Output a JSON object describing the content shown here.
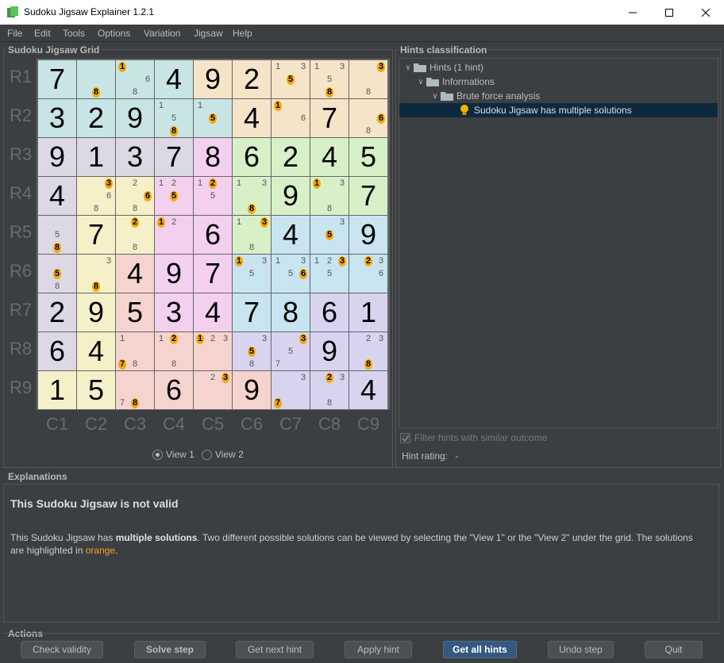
{
  "window": {
    "title": "Sudoku Jigsaw Explainer 1.2.1",
    "min": "—",
    "max": "☐",
    "close": "✕"
  },
  "menu": [
    "File",
    "Edit",
    "Tools",
    "Options",
    "Variation",
    "Jigsaw",
    "Help"
  ],
  "grid_panel": {
    "title": "Sudoku Jigsaw Grid"
  },
  "rows": [
    "R1",
    "R2",
    "R3",
    "R4",
    "R5",
    "R6",
    "R7",
    "R8",
    "R9"
  ],
  "cols": [
    "C1",
    "C2",
    "C3",
    "C4",
    "C5",
    "C6",
    "C7",
    "C8",
    "C9"
  ],
  "colors": {
    "A": "#c8e4e4",
    "B": "#f5e4c8",
    "C": "#dcd8e4",
    "D": "#d8f0c8",
    "E": "#f2d0ee",
    "F": "#f5f0c8",
    "G": "#c8e4f0",
    "H": "#f5d4d0",
    "I": "#d8d4f0"
  },
  "grid": [
    [
      {
        "v": "7",
        "r": "A"
      },
      {
        "c": "8",
        "h": "8",
        "r": "A"
      },
      {
        "c": "168",
        "h": "1",
        "r": "A"
      },
      {
        "v": "4",
        "r": "A"
      },
      {
        "v": "9",
        "r": "B"
      },
      {
        "v": "2",
        "r": "B"
      },
      {
        "c": "135",
        "h": "5",
        "r": "B"
      },
      {
        "c": "1358",
        "h": "8",
        "r": "B"
      },
      {
        "c": "38",
        "h": "3",
        "r": "B"
      }
    ],
    [
      {
        "v": "3",
        "r": "A"
      },
      {
        "v": "2",
        "r": "A"
      },
      {
        "v": "9",
        "r": "A"
      },
      {
        "c": "158",
        "h": "8",
        "r": "A"
      },
      {
        "c": "15",
        "h": "5",
        "r": "A"
      },
      {
        "v": "4",
        "r": "B"
      },
      {
        "c": "16",
        "h": "1",
        "r": "B"
      },
      {
        "v": "7",
        "r": "B"
      },
      {
        "c": "68",
        "h": "6",
        "r": "B"
      }
    ],
    [
      {
        "v": "9",
        "r": "C"
      },
      {
        "v": "1",
        "r": "C"
      },
      {
        "v": "3",
        "r": "C"
      },
      {
        "v": "7",
        "r": "C"
      },
      {
        "v": "8",
        "r": "E"
      },
      {
        "v": "6",
        "r": "D"
      },
      {
        "v": "2",
        "r": "D"
      },
      {
        "v": "4",
        "r": "D"
      },
      {
        "v": "5",
        "r": "D"
      }
    ],
    [
      {
        "v": "4",
        "r": "C"
      },
      {
        "c": "368",
        "h": "3",
        "r": "F"
      },
      {
        "c": "268",
        "h": "6",
        "r": "F"
      },
      {
        "c": "125",
        "h": "5",
        "r": "E"
      },
      {
        "c": "125",
        "h": "2",
        "r": "E"
      },
      {
        "c": "138",
        "h": "8",
        "r": "D"
      },
      {
        "v": "9",
        "r": "D"
      },
      {
        "c": "138",
        "h": "1",
        "r": "D"
      },
      {
        "v": "7",
        "r": "D"
      }
    ],
    [
      {
        "c": "58",
        "h": "8",
        "r": "C"
      },
      {
        "v": "7",
        "r": "F"
      },
      {
        "c": "28",
        "h": "2",
        "r": "F"
      },
      {
        "c": "12",
        "h": "1",
        "r": "E"
      },
      {
        "v": "6",
        "r": "E"
      },
      {
        "c": "138",
        "h": "3",
        "r": "D"
      },
      {
        "v": "4",
        "r": "G"
      },
      {
        "c": "35",
        "h": "5",
        "r": "G"
      },
      {
        "v": "9",
        "r": "G"
      }
    ],
    [
      {
        "c": "58",
        "h": "5",
        "r": "C"
      },
      {
        "c": "38",
        "h": "8",
        "r": "F"
      },
      {
        "v": "4",
        "r": "H"
      },
      {
        "v": "9",
        "r": "E"
      },
      {
        "v": "7",
        "r": "E"
      },
      {
        "c": "135",
        "h": "1",
        "r": "G"
      },
      {
        "c": "1356",
        "h": "6",
        "r": "G"
      },
      {
        "c": "1235",
        "h": "3",
        "r": "G"
      },
      {
        "c": "236",
        "h": "2",
        "r": "G"
      }
    ],
    [
      {
        "v": "2",
        "r": "C"
      },
      {
        "v": "9",
        "r": "F"
      },
      {
        "v": "5",
        "r": "H"
      },
      {
        "v": "3",
        "r": "E"
      },
      {
        "v": "4",
        "r": "E"
      },
      {
        "v": "7",
        "r": "G"
      },
      {
        "v": "8",
        "r": "G"
      },
      {
        "v": "6",
        "r": "I"
      },
      {
        "v": "1",
        "r": "I"
      }
    ],
    [
      {
        "v": "6",
        "r": "C"
      },
      {
        "v": "4",
        "r": "F"
      },
      {
        "c": "178",
        "h": "7",
        "r": "H"
      },
      {
        "c": "128",
        "h": "2",
        "r": "H"
      },
      {
        "c": "123",
        "h": "1",
        "r": "H"
      },
      {
        "c": "358",
        "h": "5",
        "r": "I"
      },
      {
        "c": "357",
        "h": "3",
        "r": "I"
      },
      {
        "v": "9",
        "r": "I"
      },
      {
        "c": "238",
        "h": "8",
        "r": "I"
      }
    ],
    [
      {
        "v": "1",
        "r": "F"
      },
      {
        "v": "5",
        "r": "F"
      },
      {
        "c": "78",
        "h": "8",
        "r": "H"
      },
      {
        "v": "6",
        "r": "H"
      },
      {
        "c": "23",
        "h": "3",
        "r": "H"
      },
      {
        "v": "9",
        "r": "H"
      },
      {
        "c": "37",
        "h": "7",
        "r": "I"
      },
      {
        "c": "238",
        "h": "2",
        "r": "I"
      },
      {
        "v": "4",
        "r": "I"
      }
    ]
  ],
  "view": {
    "view1": "View 1",
    "view2": "View 2",
    "selected": "View 1"
  },
  "hints_panel": {
    "title": "Hints classification",
    "tree": [
      {
        "label": "Hints (1 hint)",
        "level": 0
      },
      {
        "label": "Informations",
        "level": 1
      },
      {
        "label": "Brute force analysis",
        "level": 2
      },
      {
        "label": "Sudoku Jigsaw has multiple solutions",
        "level": 3
      }
    ],
    "filter_label": "Filter hints with similar outcome",
    "rating_label": "Hint rating:",
    "rating_value": "-"
  },
  "explanations": {
    "title": "Explanations",
    "heading": "This Sudoku Jigsaw is not valid",
    "text_1": "This Sudoku Jigsaw has ",
    "text_bold": "multiple solutions",
    "text_2": ". Two different possible solutions can be viewed by selecting the \"View 1\" or the \"View 2\" under the grid. The solutions are highlighted in ",
    "text_orange": "orange",
    "text_3": "."
  },
  "actions": {
    "title": "Actions",
    "buttons": [
      "Check validity",
      "Solve step",
      "Get next hint",
      "Apply hint",
      "Get all hints",
      "Undo step",
      "Quit"
    ]
  }
}
